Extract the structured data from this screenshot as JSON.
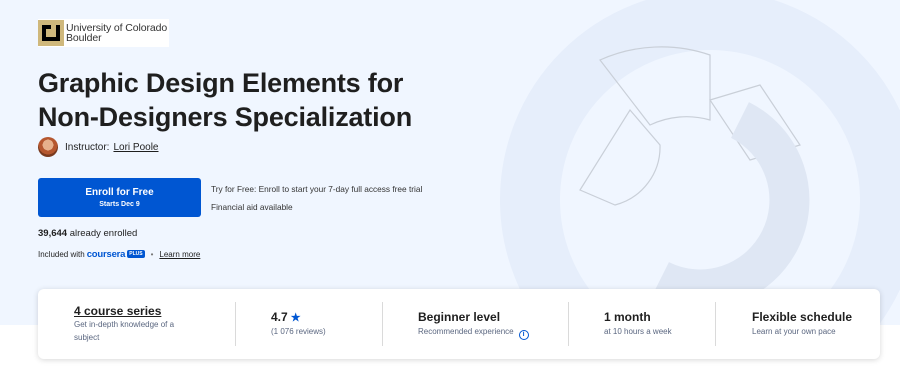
{
  "university": {
    "name_line1": "University of Colorado",
    "name_line2": "Boulder"
  },
  "course": {
    "title": "Graphic Design Elements for Non-Designers Specialization"
  },
  "instructor": {
    "label": "Instructor:",
    "name": "Lori Poole"
  },
  "enroll": {
    "button_label": "Enroll for Free",
    "button_sublabel": "Starts Dec 9",
    "trial_text": "Try for Free: Enroll to start your 7-day full access free trial",
    "financial_aid": "Financial aid available"
  },
  "enrollment": {
    "count": "39,644",
    "suffix": "already enrolled"
  },
  "plus": {
    "included_with": "Included with",
    "brand": "coursera",
    "badge": "PLUS",
    "learn_more": "Learn more"
  },
  "stats": {
    "series": {
      "title": "4 course series",
      "desc_line1": "Get in-depth knowledge of a",
      "desc_line2": "subject"
    },
    "rating": {
      "value": "4.7",
      "reviews": "(1 076 reviews)"
    },
    "level": {
      "title": "Beginner level",
      "desc": "Recommended experience"
    },
    "duration": {
      "title": "1 month",
      "desc": "at 10 hours a week"
    },
    "schedule": {
      "title": "Flexible schedule",
      "desc": "Learn at your own pace"
    }
  },
  "colors": {
    "accent": "#0056d2",
    "hero_bg": "#f0f6ff"
  },
  "icons": {
    "star": "star-icon",
    "info": "info-icon",
    "university_logo": "cu-logo-icon"
  }
}
